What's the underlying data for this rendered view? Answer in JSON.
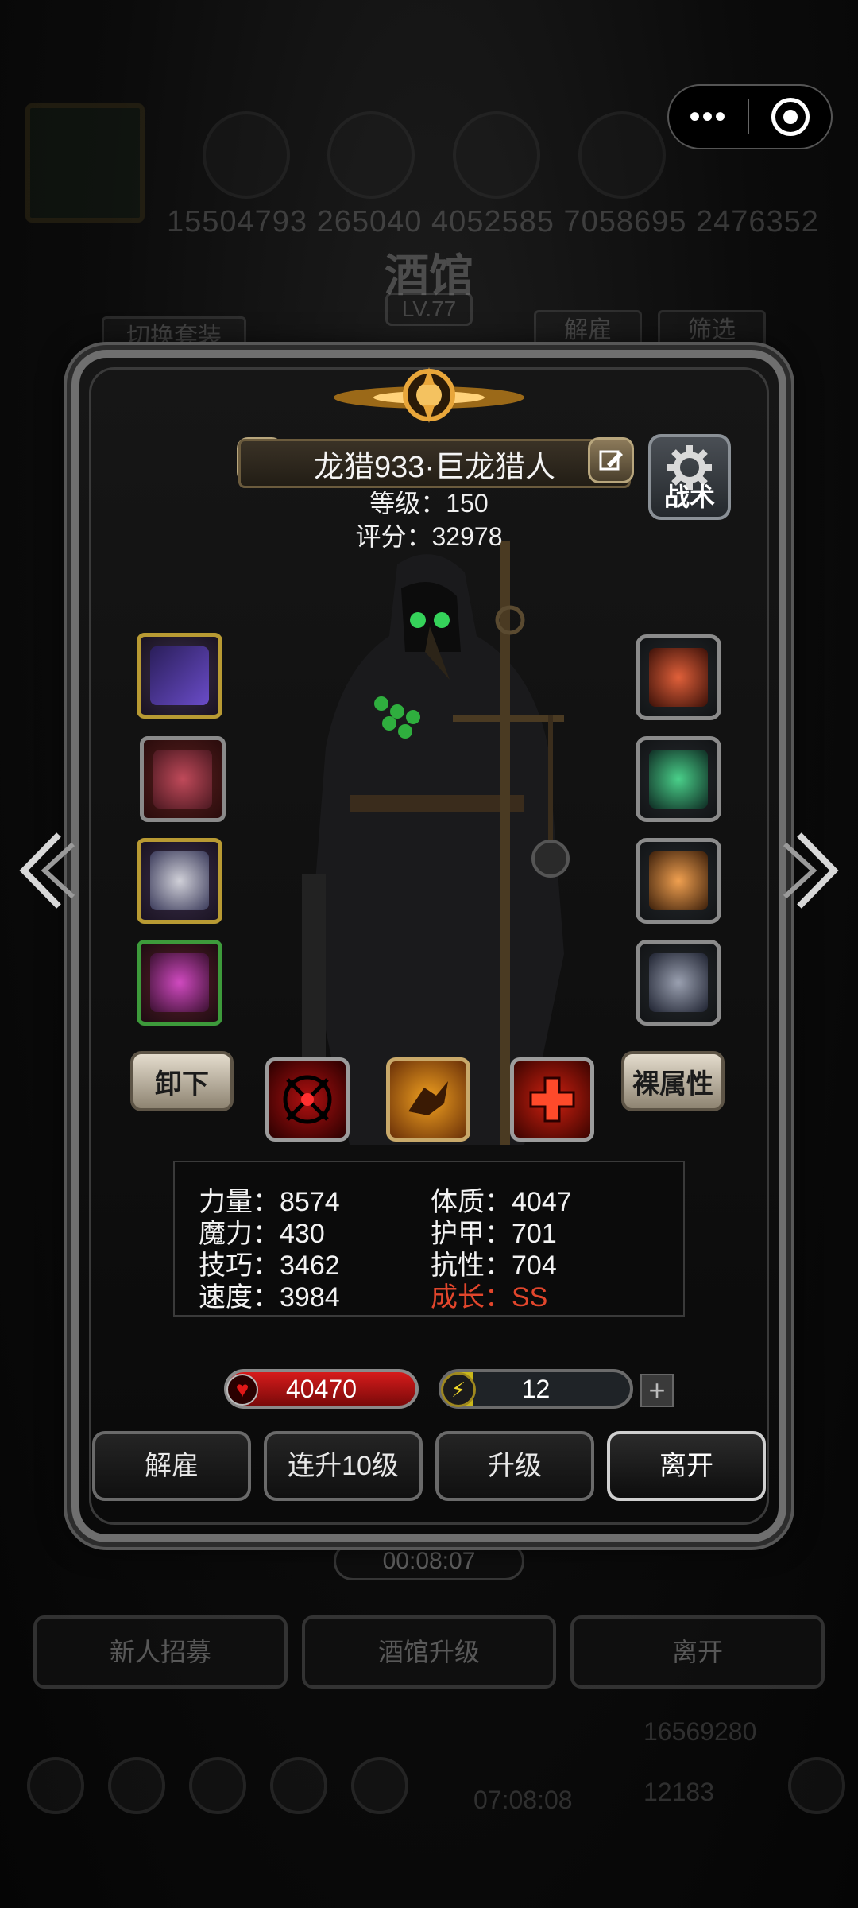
{
  "capsule": {
    "more_glyph": "•••",
    "close_glyph": "◎"
  },
  "background": {
    "numbers": "15504793  265040  4052585  7058695  2476352",
    "title": "酒馆",
    "level": "LV.77",
    "switch_outfit": "切换套装",
    "dismiss": "解雇",
    "filter": "筛选",
    "timer": "00:08:07",
    "bottom_buttons": [
      "新人招募",
      "酒馆升级",
      "离开"
    ],
    "gold": "16569280",
    "gems": "12183",
    "bottom_timer": "07:08:08"
  },
  "hero": {
    "name": "龙猎933·巨龙猎人",
    "level_line": "等级：150",
    "score_line": "评分：32978",
    "tactics_label": "战术"
  },
  "equipment": {
    "left": [
      "pistol-icon",
      "armor-icon",
      "ring-icon",
      "helmet-icon"
    ],
    "right": [
      "amulet-icon",
      "crystal-icon",
      "lantern-icon",
      "bracer-icon"
    ]
  },
  "controls": {
    "unequip": "卸下",
    "base_attr": "裸属性",
    "skills": [
      "target-skill-icon",
      "beast-skill-icon",
      "heal-skill-icon"
    ]
  },
  "stats": {
    "strength": "力量：8574",
    "magic": "魔力：430",
    "skill": "技巧：3462",
    "speed": "速度：3984",
    "constitution": "体质：4047",
    "armor": "护甲：701",
    "resistance": "抗性：704",
    "growth": "成长：SS"
  },
  "resources": {
    "hp": "40470",
    "energy": "12",
    "energy_fill": 0.16,
    "plus": "+"
  },
  "actions": {
    "dismiss": "解雇",
    "level_up_10": "连升10级",
    "level_up": "升级",
    "leave": "离开"
  },
  "colors": {
    "growth": "#e2462c",
    "hp": "#d61b1b",
    "energy": "#c9b71a"
  }
}
